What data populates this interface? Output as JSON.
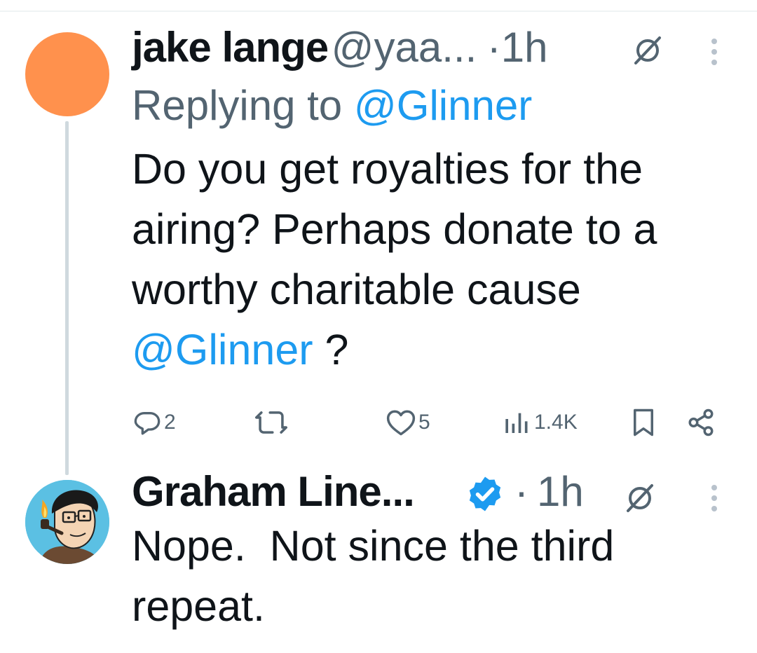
{
  "tweets": [
    {
      "display_name": "jake lange",
      "handle": "@yaa...",
      "separator": "·",
      "time": "1h",
      "replying_prefix": "Replying to",
      "replying_to": "@Glinner",
      "text_lines": [
        "Do you get royalties for the",
        "airing? Perhaps donate to a",
        "worthy charitable cause"
      ],
      "text_mention": "@Glinner",
      "text_suffix": " ?",
      "avatar_color": "#ff914d",
      "actions": {
        "replies": "2",
        "retweets": "",
        "likes": "5",
        "views": "1.4K"
      },
      "icons": {
        "reply": "reply-icon",
        "retweet": "retweet-icon",
        "like": "heart-icon",
        "views": "views-icon",
        "bookmark": "bookmark-icon",
        "share": "share-icon",
        "mute": "grok-icon",
        "more": "more-icon"
      }
    },
    {
      "display_name": "Graham Line...",
      "verified": true,
      "separator": "·",
      "time": "1h",
      "text_lines": [
        "Nope.  Not since the third",
        "repeat."
      ]
    }
  ],
  "colors": {
    "text": "#0f1419",
    "secondary": "#536471",
    "accent": "#1d9bf0",
    "thread_line": "#cfd9de"
  }
}
